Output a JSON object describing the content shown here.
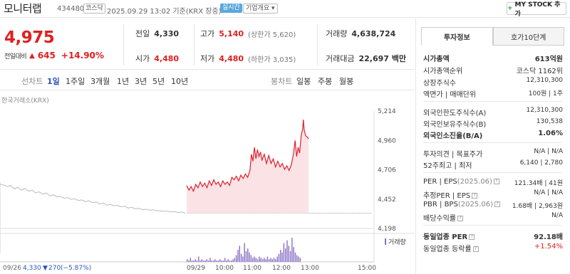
{
  "header": {
    "name": "모니터랩",
    "code": "434480",
    "market": "코스닥",
    "datetime": "2025.09.29 13:02 기준(KRX 장중)",
    "realtime": "실시간",
    "corp_info": "기업개요 ▾",
    "mystock": "MY STOCK 추가",
    "plus": "+"
  },
  "quote": {
    "price": "4,975",
    "change_label": "전일대비",
    "change_abs": "645",
    "change_pct": "+14.90%",
    "prev_label": "전일",
    "prev": "4,330",
    "open_label": "시가",
    "open": "4,480",
    "high_label": "고가",
    "high": "5,140",
    "upper": "(상한가 5,620)",
    "low_label": "저가",
    "low": "4,480",
    "lower": "(하한가 3,035)",
    "vol_label": "거래량",
    "vol": "4,638,724",
    "amt_label": "거래대금",
    "amt": "22,697 백만"
  },
  "tabs": {
    "line": "선차트",
    "d1": "1일",
    "w1": "1주일",
    "m3": "3개월",
    "y1": "1년",
    "y3": "3년",
    "y5": "5년",
    "y10": "10년",
    "candle": "봉차트",
    "day": "일봉",
    "week": "주봉",
    "month": "월봉"
  },
  "chart_data": {
    "type": "line",
    "source": "한국거래소(KRX)",
    "ylim": [
      4198,
      5214
    ],
    "yticks": [
      "5,214",
      "4,960",
      "4,706",
      "4,452",
      "4,198"
    ],
    "xticks": [
      "09/29",
      "10:00",
      "11:00",
      "12:00",
      "13:00",
      "15:00"
    ],
    "prev_day_label": "09/26",
    "prev_day_price": "4,330",
    "prev_day_change": "270",
    "prev_day_pct": "(−5.87%)",
    "volume_label": "거래량",
    "prev_close": 4330,
    "prev_series": [
      4580,
      4575,
      4560,
      4570,
      4540,
      4555,
      4530,
      4545,
      4520,
      4530,
      4505,
      4515,
      4495,
      4505,
      4480,
      4490,
      4470,
      4475,
      4460,
      4465,
      4450,
      4455,
      4440,
      4445,
      4430,
      4438,
      4420,
      4428,
      4410,
      4418,
      4400,
      4405,
      4395,
      4398,
      4385,
      4390,
      4375,
      4380,
      4368,
      4372,
      4360,
      4365,
      4355,
      4360,
      4350,
      4352,
      4345,
      4348,
      4340,
      4345,
      4335,
      4340,
      4330
    ],
    "series": [
      {
        "x": 0,
        "y": 4570
      },
      {
        "x": 3,
        "y": 4530
      },
      {
        "x": 6,
        "y": 4560
      },
      {
        "x": 9,
        "y": 4520
      },
      {
        "x": 12,
        "y": 4580
      },
      {
        "x": 15,
        "y": 4550
      },
      {
        "x": 18,
        "y": 4600
      },
      {
        "x": 21,
        "y": 4560
      },
      {
        "x": 24,
        "y": 4590
      },
      {
        "x": 27,
        "y": 4550
      },
      {
        "x": 30,
        "y": 4610
      },
      {
        "x": 33,
        "y": 4570
      },
      {
        "x": 36,
        "y": 4620
      },
      {
        "x": 39,
        "y": 4580
      },
      {
        "x": 42,
        "y": 4600
      },
      {
        "x": 45,
        "y": 4560
      },
      {
        "x": 48,
        "y": 4610
      },
      {
        "x": 51,
        "y": 4580
      },
      {
        "x": 54,
        "y": 4600
      },
      {
        "x": 57,
        "y": 4570
      },
      {
        "x": 60,
        "y": 4640
      },
      {
        "x": 63,
        "y": 4620
      },
      {
        "x": 66,
        "y": 4650
      },
      {
        "x": 69,
        "y": 4610
      },
      {
        "x": 72,
        "y": 4660
      },
      {
        "x": 75,
        "y": 4630
      },
      {
        "x": 78,
        "y": 4670
      },
      {
        "x": 81,
        "y": 4640
      },
      {
        "x": 84,
        "y": 4700
      },
      {
        "x": 86,
        "y": 4840
      },
      {
        "x": 88,
        "y": 4780
      },
      {
        "x": 90,
        "y": 4900
      },
      {
        "x": 92,
        "y": 4800
      },
      {
        "x": 94,
        "y": 4880
      },
      {
        "x": 96,
        "y": 4820
      },
      {
        "x": 98,
        "y": 4860
      },
      {
        "x": 100,
        "y": 4790
      },
      {
        "x": 103,
        "y": 4840
      },
      {
        "x": 106,
        "y": 4760
      },
      {
        "x": 109,
        "y": 4830
      },
      {
        "x": 112,
        "y": 4760
      },
      {
        "x": 115,
        "y": 4800
      },
      {
        "x": 118,
        "y": 4730
      },
      {
        "x": 121,
        "y": 4780
      },
      {
        "x": 124,
        "y": 4730
      },
      {
        "x": 127,
        "y": 4760
      },
      {
        "x": 130,
        "y": 4710
      },
      {
        "x": 133,
        "y": 4740
      },
      {
        "x": 136,
        "y": 4700
      },
      {
        "x": 139,
        "y": 4750
      },
      {
        "x": 142,
        "y": 4850
      },
      {
        "x": 144,
        "y": 4960
      },
      {
        "x": 146,
        "y": 4820
      },
      {
        "x": 148,
        "y": 4900
      },
      {
        "x": 150,
        "y": 4850
      },
      {
        "x": 152,
        "y": 5000
      },
      {
        "x": 154,
        "y": 5060
      },
      {
        "x": 155,
        "y": 5140
      },
      {
        "x": 156,
        "y": 5050
      },
      {
        "x": 158,
        "y": 5000
      },
      {
        "x": 160,
        "y": 4990
      },
      {
        "x": 162,
        "y": 4975
      }
    ],
    "x_extent": [
      0,
      246
    ],
    "volume": [
      2,
      1,
      3,
      1,
      1,
      2,
      1,
      4,
      1,
      2,
      1,
      1,
      2,
      1,
      3,
      1,
      1,
      2,
      1,
      1,
      2,
      1,
      1,
      3,
      1,
      2,
      1,
      1,
      2,
      3,
      5,
      9,
      12,
      6,
      4,
      14,
      8,
      10,
      7,
      5,
      3,
      4,
      3,
      2,
      4,
      3,
      2,
      3,
      2,
      4,
      2,
      3,
      2,
      3,
      2,
      4,
      6,
      9,
      7,
      14,
      10,
      16,
      12,
      8,
      18,
      11,
      7,
      5,
      4,
      3
    ]
  },
  "side": {
    "tab_info": "투자정보",
    "tab_order": "호가10단계",
    "cap_label": "시가총액",
    "cap": "613억원",
    "rank_label": "시가총액순위",
    "rank": "코스닥 1162위",
    "shares_label": "상장주식수",
    "shares": "12,310,300",
    "par_label": "액면가 | 매매단위",
    "par": "100원 | 1주",
    "fl_label": "외국인한도주식수(A)",
    "fl": "12,310,300",
    "fh_label": "외국인보유주식수(B)",
    "fh": "130,538",
    "fr_label": "외국인소진율(B/A)",
    "fr": "1.06%",
    "op_label": "투자의견 | 목표주가",
    "op": "N/A | N/A",
    "w52_label": "52주최고 | 최저",
    "w52": "6,140 | 2,780",
    "per_label": "PER | EPS",
    "per_date": "(2025.06)",
    "per": "121.34배 | 41원",
    "eper_label": "추정PER | EPS",
    "eper": "N/A | N/A",
    "pbr_label": "PBR | BPS",
    "pbr_date": "(2025.06)",
    "pbr": "1.68배 | 2,963원",
    "div_label": "배당수익률",
    "div": "N/A",
    "sper_label": "동일업종 PER",
    "sper": "92.18배",
    "srate_label": "동일업종 등락률",
    "srate": "+1.54%"
  }
}
